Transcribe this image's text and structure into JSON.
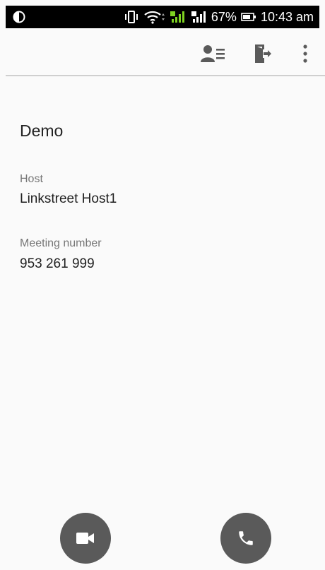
{
  "status_bar": {
    "battery": "67%",
    "time": "10:43 am"
  },
  "toolbar": {
    "icons": [
      "participants-icon",
      "leave-meeting-icon",
      "more-options-icon"
    ]
  },
  "meeting": {
    "title": "Demo",
    "host_label": "Host",
    "host_value": "Linkstreet Host1",
    "number_label": "Meeting number",
    "number_value": "953 261 999"
  },
  "actions": {
    "icons": [
      "video-camera-icon",
      "phone-icon"
    ]
  },
  "colors": {
    "background": "#fafafa",
    "status_bar": "#000000",
    "signal_green": "#7ed321",
    "round_button": "#5a5a5a"
  }
}
